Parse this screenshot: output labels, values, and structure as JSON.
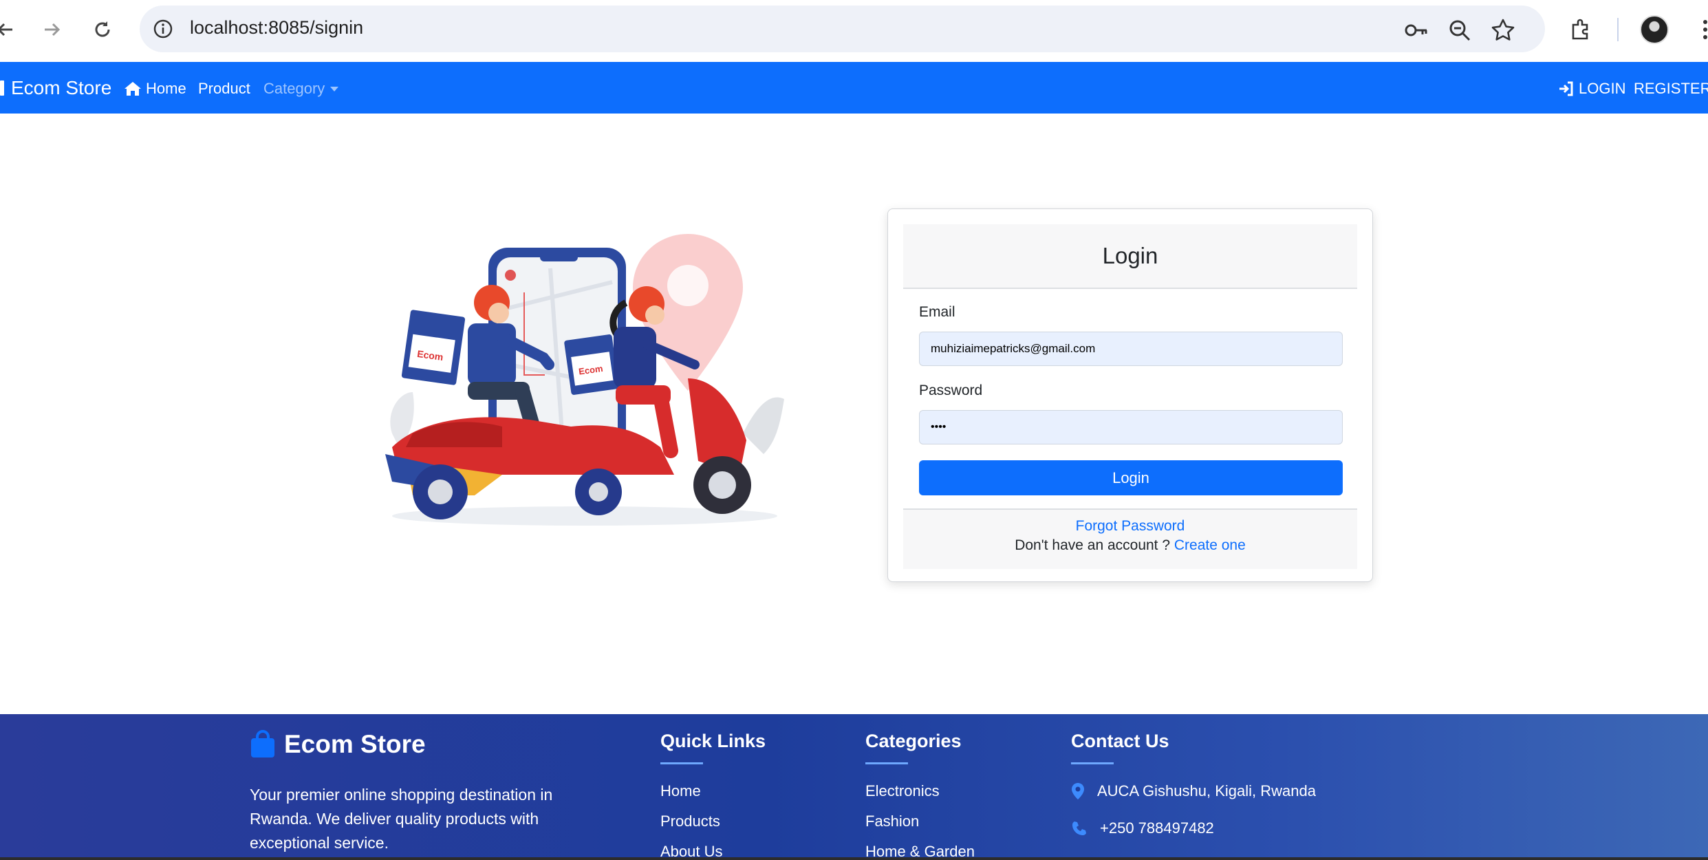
{
  "browser": {
    "url": "localhost:8085/signin"
  },
  "navbar": {
    "brand": "Ecom Store",
    "links": [
      {
        "label": "Home",
        "icon": "home-icon"
      },
      {
        "label": "Product"
      },
      {
        "label": "Category"
      }
    ],
    "login_label": "LOGIN",
    "register_label": "REGISTER"
  },
  "login_card": {
    "title": "Login",
    "email_label": "Email",
    "email_value": "muhiziaimepatricks@gmail.com",
    "password_label": "Password",
    "password_value": "••••",
    "submit_label": "Login",
    "forgot_label": "Forgot Password",
    "no_account_text": "Don't have an account ?",
    "create_label": "Create one"
  },
  "footer": {
    "brand": "Ecom Store",
    "description": "Your premier online shopping destination in Rwanda. We deliver quality products with exceptional service.",
    "quick_links": {
      "title": "Quick Links",
      "items": [
        "Home",
        "Products",
        "About Us"
      ]
    },
    "categories": {
      "title": "Categories",
      "items": [
        "Electronics",
        "Fashion",
        "Home & Garden"
      ]
    },
    "contact": {
      "title": "Contact Us",
      "address": "AUCA Gishushu, Kigali, Rwanda",
      "phone": "+250 788497482"
    }
  },
  "colors": {
    "primary": "#0d6efd",
    "footer_bg": "#1e3d9c"
  }
}
